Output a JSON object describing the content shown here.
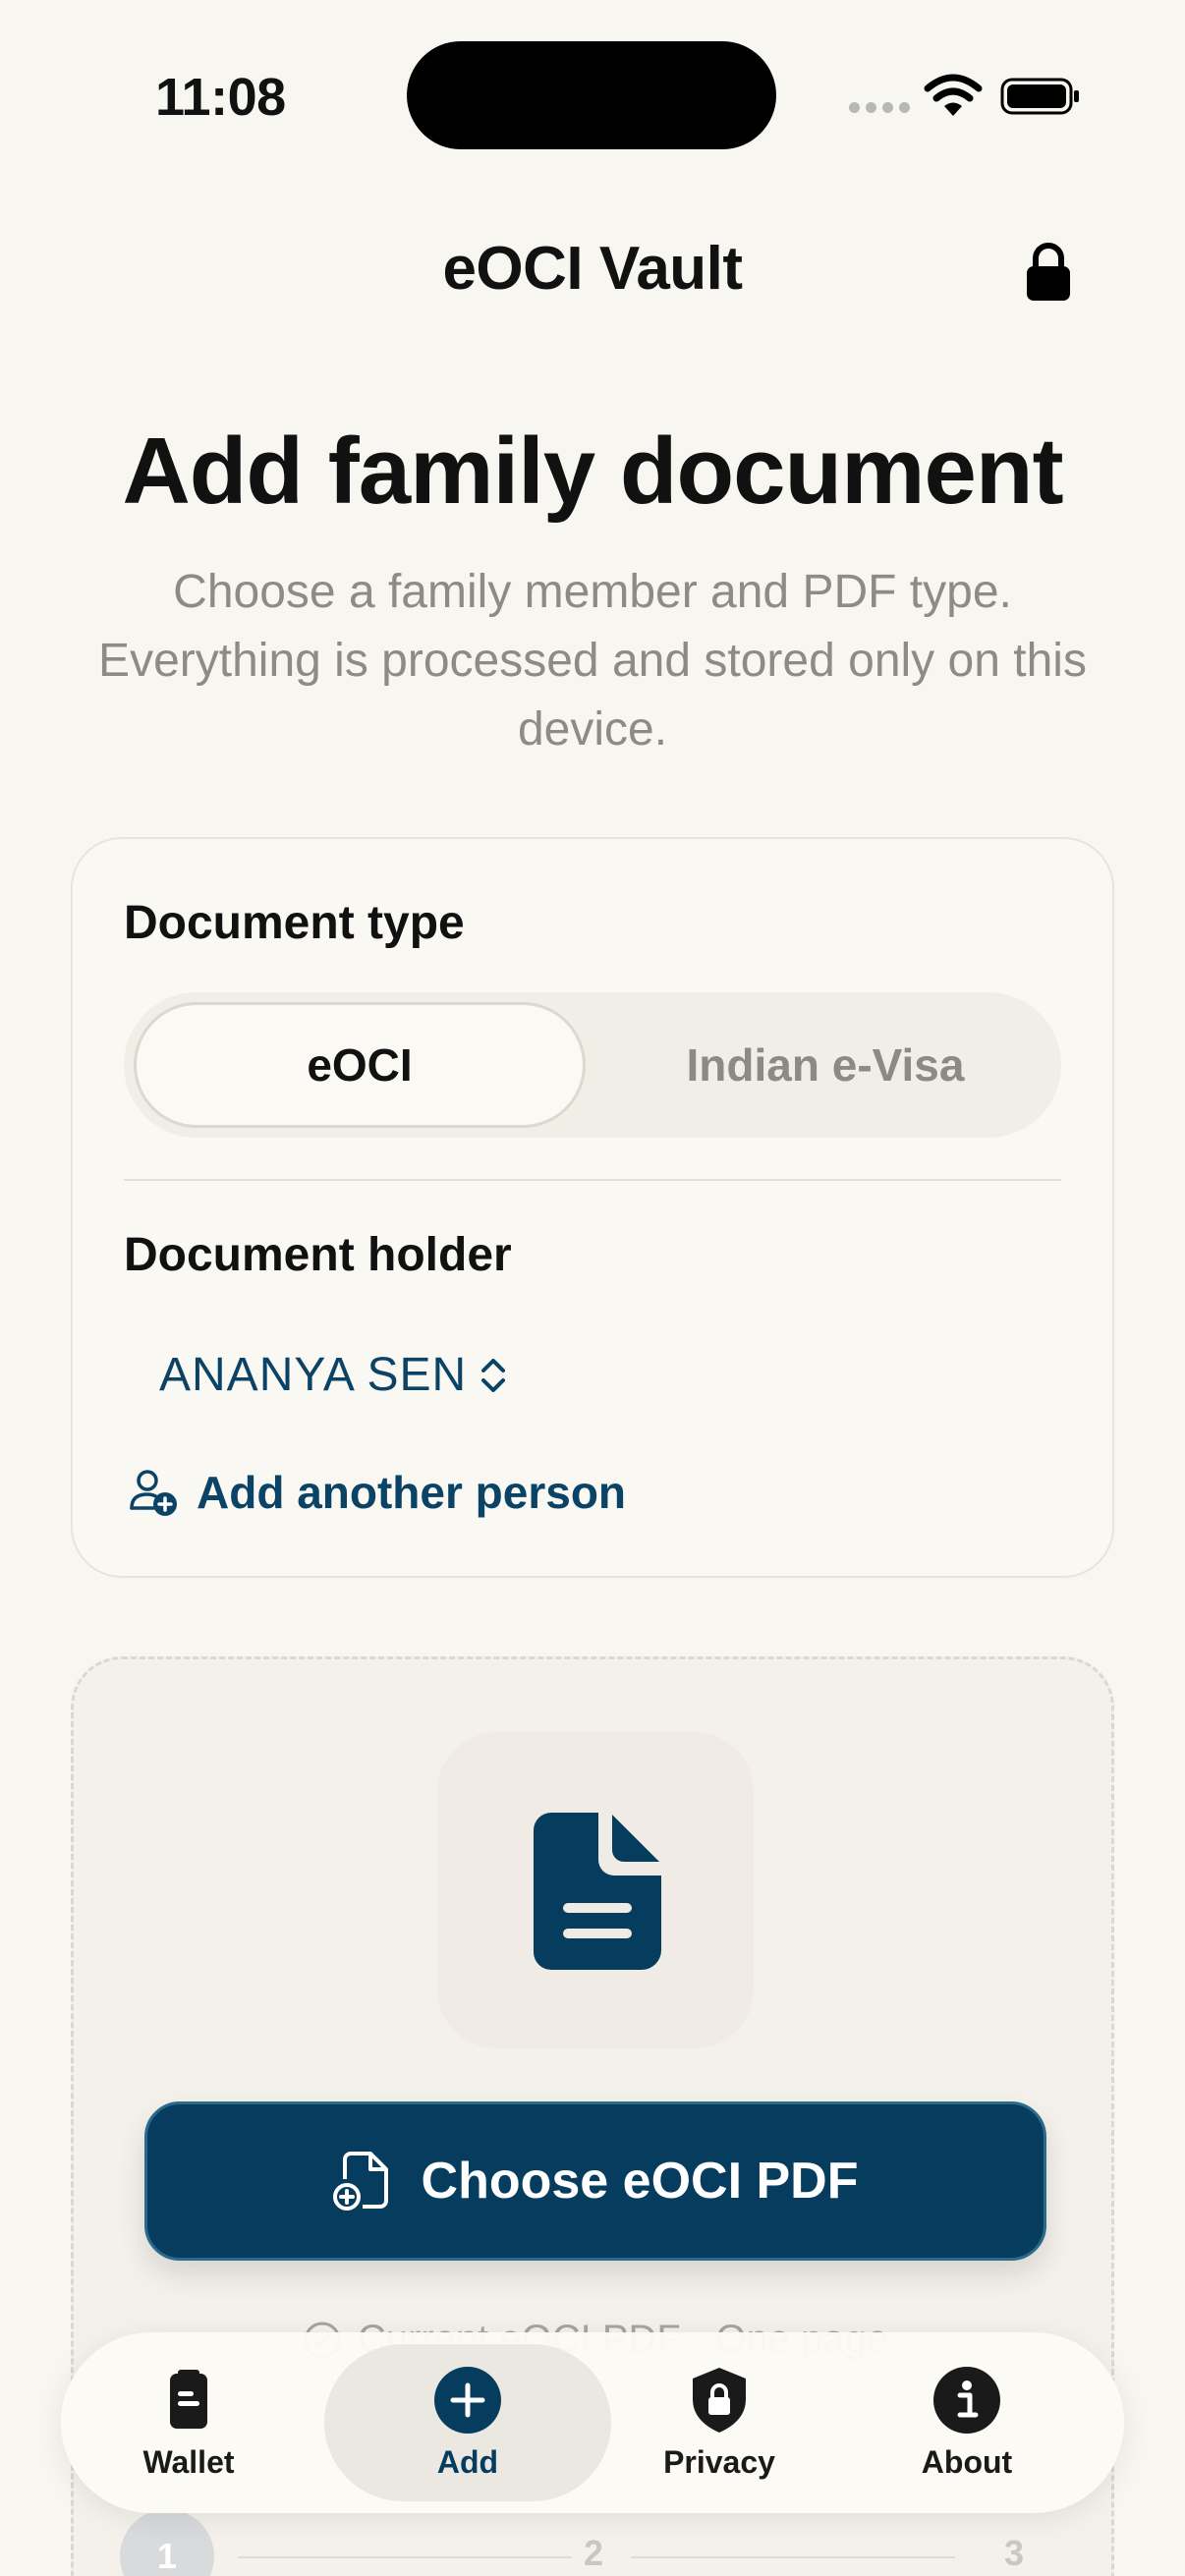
{
  "status": {
    "time": "11:08"
  },
  "nav": {
    "title": "eOCI Vault"
  },
  "header": {
    "title": "Add family document",
    "subtitle": "Choose a family member and PDF type. Everything is processed and stored only on this device."
  },
  "document_type": {
    "label": "Document type",
    "options": [
      "eOCI",
      "Indian e-Visa"
    ],
    "selected": "eOCI"
  },
  "holder": {
    "label": "Document holder",
    "selected": "ANANYA SEN",
    "add_label": "Add another person"
  },
  "upload": {
    "button_label": "Choose eOCI PDF",
    "hint": "Current eOCI PDF · One page"
  },
  "stepper": {
    "steps": [
      "1",
      "2",
      "3"
    ]
  },
  "tabbar": {
    "items": [
      {
        "label": "Wallet",
        "icon": "wallet-icon"
      },
      {
        "label": "Add",
        "icon": "plus-circle-icon"
      },
      {
        "label": "Privacy",
        "icon": "shield-lock-icon"
      },
      {
        "label": "About",
        "icon": "info-circle-icon"
      }
    ],
    "active": "Add"
  },
  "colors": {
    "accent": "#063d5e",
    "background": "#f8f6f0",
    "muted_text": "#8d8b87"
  }
}
